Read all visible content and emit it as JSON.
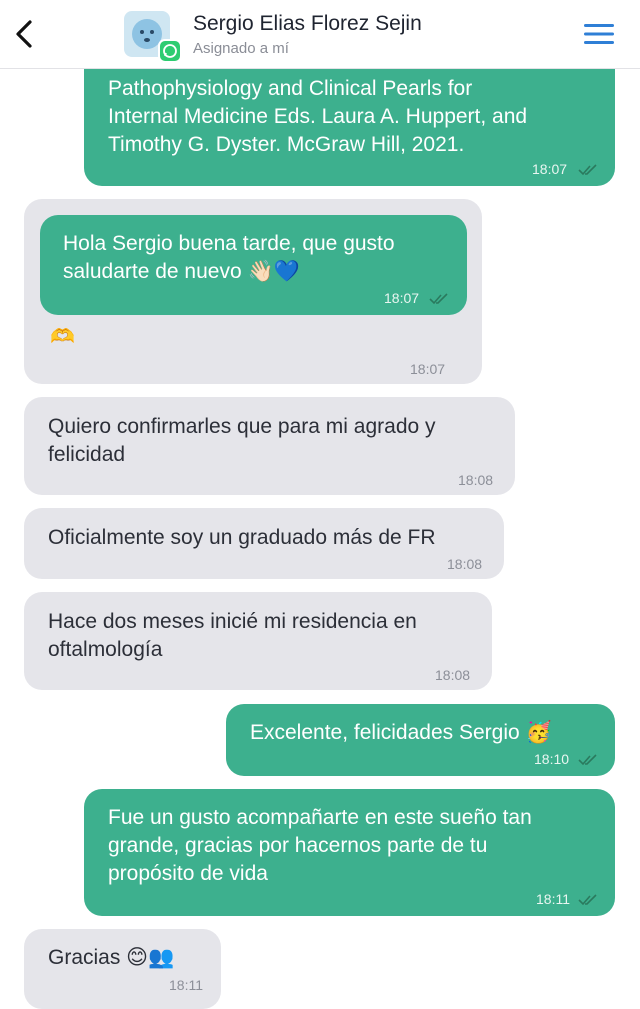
{
  "header": {
    "contact_name": "Sergio Elias Florez Sejin",
    "subtitle": "Asignado a mí",
    "back_icon": "chevron-left-icon",
    "menu_icon": "hamburger-menu-icon",
    "channel_icon": "whatsapp-icon",
    "colors": {
      "accent": "#2f7fd6",
      "outgoing": "#3db08e",
      "incoming": "#e5e5ea"
    }
  },
  "messages": [
    {
      "direction": "outgoing",
      "lines": [
        "Pathophysiology and Clinical Pearls for",
        "Internal Medicine Eds. Laura A. Huppert, and",
        "Timothy G. Dyster. McGraw Hill, 2021."
      ],
      "time": "18:07",
      "status": "read"
    },
    {
      "direction": "incoming",
      "quoted": {
        "lines": [
          "Hola Sergio buena tarde, que gusto",
          "saludarte de nuevo 👋🏻💙"
        ],
        "time": "18:07"
      },
      "text": "🫶",
      "time": "18:07"
    },
    {
      "direction": "incoming",
      "lines": [
        "Quiero confirmarles que para mi agrado y",
        "felicidad"
      ],
      "time": "18:08"
    },
    {
      "direction": "incoming",
      "lines": [
        "Oficialmente soy un graduado más de FR"
      ],
      "time": "18:08"
    },
    {
      "direction": "incoming",
      "lines": [
        "Hace dos meses inicié mi residencia en",
        "oftalmología"
      ],
      "time": "18:08"
    },
    {
      "direction": "outgoing",
      "lines": [
        "Excelente, felicidades Sergio 🥳"
      ],
      "time": "18:10",
      "status": "read"
    },
    {
      "direction": "outgoing",
      "lines": [
        "Fue un gusto acompañarte en este sueño tan",
        "grande, gracias por hacernos parte de tu",
        "propósito de vida"
      ],
      "time": "18:11",
      "status": "read"
    },
    {
      "direction": "incoming",
      "lines": [
        "Gracias 😊👥"
      ],
      "time": "18:11"
    }
  ]
}
